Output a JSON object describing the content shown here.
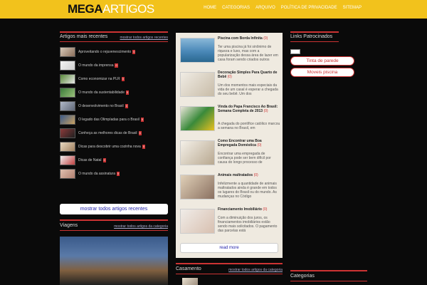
{
  "header": {
    "logo_mega": "MEGA",
    "logo_artigos": "ARTIGOS",
    "nav": [
      "HOME",
      "CATEGORIAS",
      "ARQUIVO",
      "POLÍTICA DE PRIVACIDADE",
      "SITEMAP"
    ]
  },
  "left": {
    "section_title": "Artigos mais recentes",
    "section_link": "mostrar todos artigos recentes",
    "items": [
      {
        "label": "Aproveitando o rejuvenescimento",
        "count": "0"
      },
      {
        "label": "O mundo da imprensa",
        "count": "0"
      },
      {
        "label": "Como economizar na PLR",
        "count": "0"
      },
      {
        "label": "O mundo da sustentabilidade",
        "count": "0"
      },
      {
        "label": "O desenvolvimento no Brasil",
        "count": "0"
      },
      {
        "label": "O legado das Olimpíadas para o Brasil",
        "count": "0"
      },
      {
        "label": "Conheça as melhores dicas de Brasil",
        "count": "0"
      },
      {
        "label": "Dicas para descobrir uma cozinha nova",
        "count": "0"
      },
      {
        "label": "Dicas de Natal",
        "count": "0"
      },
      {
        "label": "O mundo da assinatura",
        "count": "0"
      }
    ],
    "show_all_button": "mostrar todos artigos recentes",
    "viagens_title": "Viagens",
    "viagens_link": "mostrar todos artigos da categoria"
  },
  "center": {
    "posts": [
      {
        "title": "Piscina com Borda Infinita",
        "count": "(0)",
        "desc": "Ter uma piscina já foi sinônimo de riqueza e luxo, mas com a popularização dessa área de lazer em casa foram sendo criados outros"
      },
      {
        "title": "Decoração Simples Para Quarto de Bebê",
        "count": "(0)",
        "desc": "Um dos momentos mais especiais da vida de um casal é esperar a chegada do seu bebê. Um dos"
      },
      {
        "title": "Vinda do Papa Francisco Ao Brasil: Semana Completa de 2013",
        "count": "(0)",
        "desc": "A chegada do pontífice católico marcou a semana no Brasil, em"
      },
      {
        "title": "Como Encontrar uma Boa Empregada Doméstica",
        "count": "(0)",
        "desc": "Encontrar uma empregada de confiança pode ser bem difícil por causa do longo processo de"
      },
      {
        "title": "Animais maltratados",
        "count": "(0)",
        "desc": "Infelizmente a quantidade de animais maltratados ainda é grande em todos os lugares do Brasil ou do mundo. As mudanças no Código"
      },
      {
        "title": "Financiamento Imobiliário",
        "count": "(0)",
        "desc": "Com a diminuição dos juros, os financiamentos imobiliários estão sendo mais solicitados. O pagamento das parcelas está"
      }
    ],
    "more_button": "read more",
    "casamento_title": "Casamento",
    "casamento_link": "mostrar todos artigos da categoria"
  },
  "right": {
    "links_title": "Links Patrocinados",
    "ads": [
      "Tinta de parede",
      "Moveis piscina"
    ],
    "categorias_title": "Categorias"
  },
  "colors": {
    "header_bg": "#f2c21c",
    "accent": "#cc3333",
    "page_bg": "#0a0a0a",
    "card_bg": "#efeae0"
  }
}
